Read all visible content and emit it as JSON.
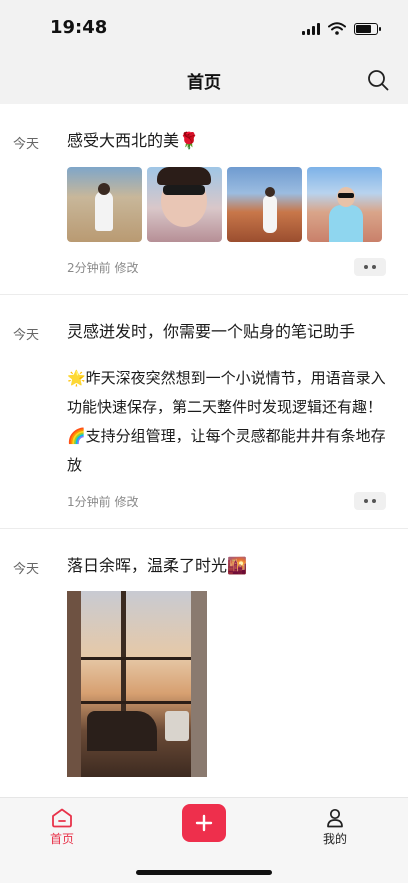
{
  "status_bar": {
    "time": "19:48",
    "battery_level": 0.7
  },
  "header": {
    "title": "首页",
    "search_icon": "search-icon"
  },
  "posts": [
    {
      "date": "今天",
      "title": "感受大西北的美🌹",
      "text": "",
      "meta": "2分钟前 修改",
      "photos": 4
    },
    {
      "date": "今天",
      "title": "灵感迸发时，你需要一个贴身的笔记助手",
      "text": "🌟昨天深夜突然想到一个小说情节，用语音录入功能快速保存，第二天整件时发现逻辑还有趣！\n🌈支持分组管理，让每个灵感都能井井有条地存放",
      "meta": "1分钟前 修改"
    },
    {
      "date": "今天",
      "title": "落日余晖，温柔了时光🌇",
      "text": "",
      "meta": ""
    }
  ],
  "tab_bar": {
    "home_label": "首页",
    "mine_label": "我的",
    "add_icon": "plus-icon",
    "active_color": "#e8334a",
    "add_color": "#ee2f4c"
  }
}
